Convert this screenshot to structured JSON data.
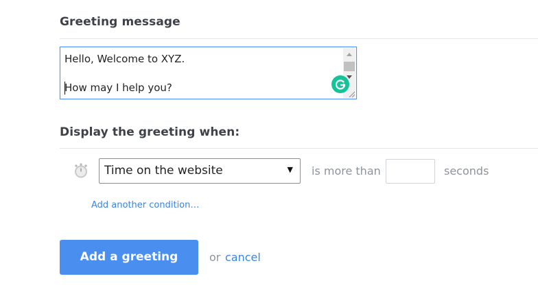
{
  "greeting_section": {
    "title": "Greeting message",
    "message_lines": [
      "Hello, Welcome to XYZ.",
      "",
      "How may I help you?"
    ]
  },
  "display_section": {
    "title": "Display the greeting when:",
    "condition": {
      "icon": "timer-icon",
      "selected_option": "Time on the website",
      "operator_label": "is more than",
      "seconds_value": "",
      "unit_label": "seconds"
    },
    "add_condition_link": "Add another condition…"
  },
  "actions": {
    "add_button": "Add a greeting",
    "or_text": "or",
    "cancel_link": "cancel"
  },
  "colors": {
    "primary_button": "#4a8ef0",
    "link": "#3a84e3",
    "focus_border": "#4d90fe",
    "grammarly": "#15c39a"
  }
}
